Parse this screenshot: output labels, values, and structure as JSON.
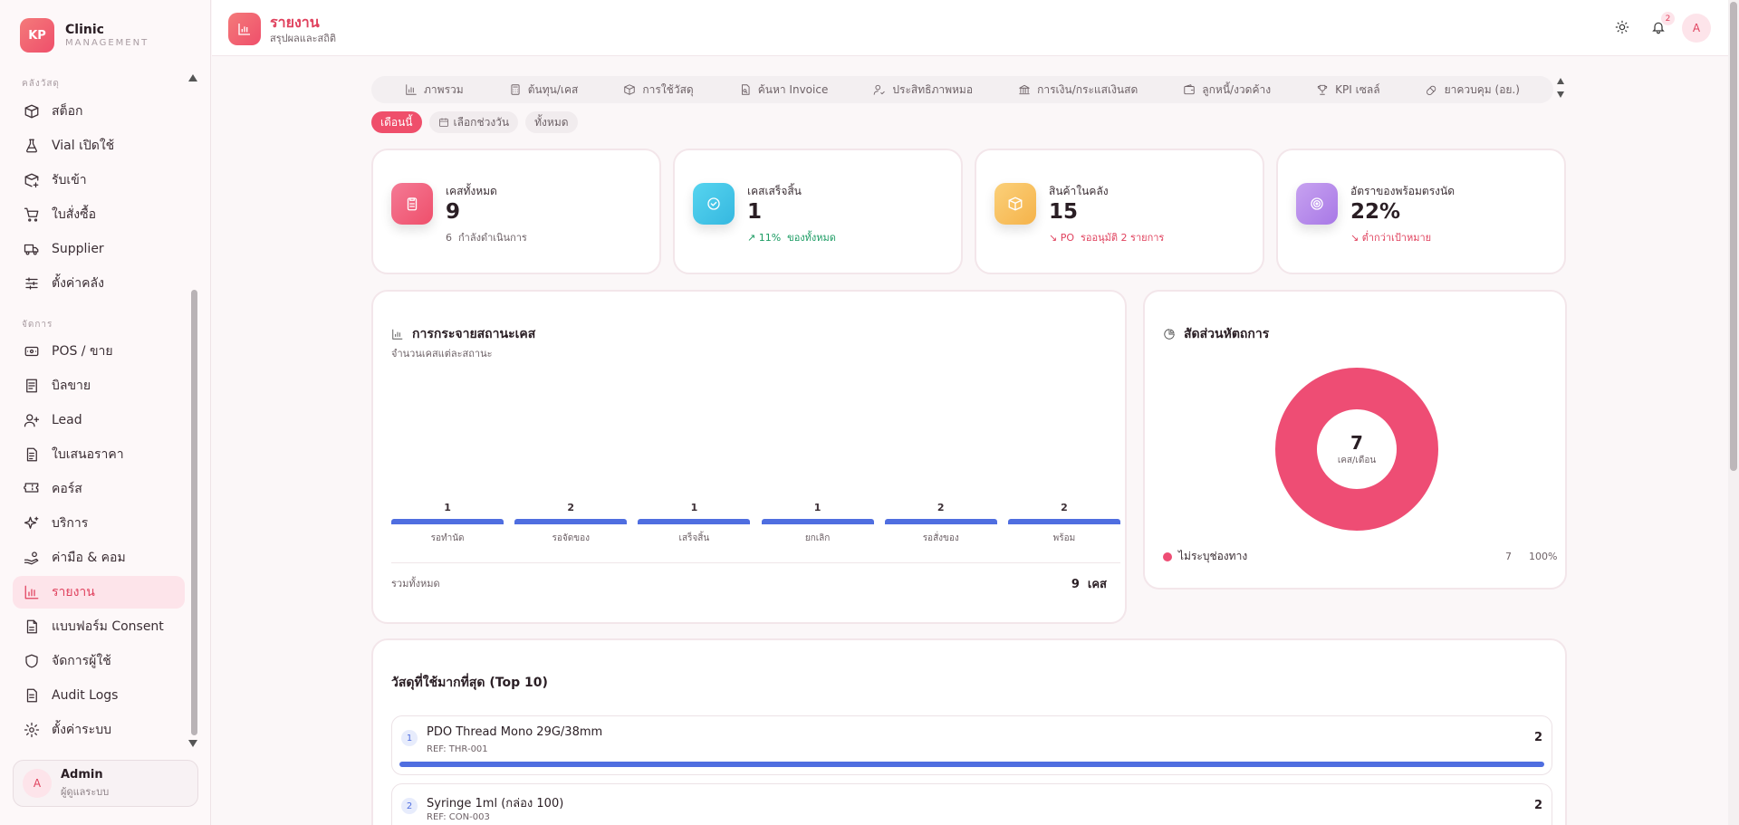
{
  "brand": {
    "logo": "KP",
    "name": "Clinic",
    "sub": "MANAGEMENT"
  },
  "sidebar": {
    "section1": "คลังวัสดุ",
    "section2": "จัดการ",
    "items": [
      {
        "label": "สต็อก",
        "icon": "box-icon"
      },
      {
        "label": "Vial เปิดใช้",
        "icon": "flask-icon"
      },
      {
        "label": "รับเข้า",
        "icon": "package-plus-icon"
      },
      {
        "label": "ใบสั่งซื้อ",
        "icon": "cart-icon"
      },
      {
        "label": "Supplier",
        "icon": "truck-icon"
      },
      {
        "label": "ตั้งค่าคลัง",
        "icon": "sliders-icon"
      },
      {
        "label": "POS / ขาย",
        "icon": "pos-icon"
      },
      {
        "label": "บิลขาย",
        "icon": "receipt-icon"
      },
      {
        "label": "Lead",
        "icon": "user-plus-icon"
      },
      {
        "label": "ใบเสนอราคา",
        "icon": "quote-icon"
      },
      {
        "label": "คอร์ส",
        "icon": "ticket-icon"
      },
      {
        "label": "บริการ",
        "icon": "sparkle-icon"
      },
      {
        "label": "ค่ามือ & คอม",
        "icon": "hand-coins-icon"
      },
      {
        "label": "รายงาน",
        "icon": "chart-icon"
      },
      {
        "label": "แบบฟอร์ม Consent",
        "icon": "document-icon"
      },
      {
        "label": "จัดการผู้ใช้",
        "icon": "shield-icon"
      },
      {
        "label": "Audit Logs",
        "icon": "log-icon"
      },
      {
        "label": "ตั้งค่าระบบ",
        "icon": "gear-icon"
      }
    ],
    "user": {
      "avatar": "A",
      "name": "Admin",
      "role": "ผู้ดูแลระบบ"
    }
  },
  "header": {
    "title": "รายงาน",
    "subtitle": "สรุปผลและสถิติ",
    "notification_count": "2",
    "avatar": "A"
  },
  "tabs": [
    {
      "label": "ภาพรวม",
      "icon": "bar-chart-icon"
    },
    {
      "label": "ต้นทุน/เคส",
      "icon": "calculator-icon"
    },
    {
      "label": "การใช้วัสดุ",
      "icon": "box-icon"
    },
    {
      "label": "ค้นหา Invoice",
      "icon": "file-search-icon"
    },
    {
      "label": "ประสิทธิภาพหมอ",
      "icon": "user-check-icon"
    },
    {
      "label": "การเงิน/กระแสเงินสด",
      "icon": "bank-icon"
    },
    {
      "label": "ลูกหนี้/งวดค้าง",
      "icon": "wallet-icon"
    },
    {
      "label": "KPI เซลล์",
      "icon": "trophy-icon"
    },
    {
      "label": "ยาควบคุม (อย.)",
      "icon": "pill-icon"
    }
  ],
  "filters": {
    "this_month": "เดือนนี้",
    "date_range": "เลือกช่วงวัน",
    "all": "ทั้งหมด"
  },
  "stats": [
    {
      "label": "เคสทั้งหมด",
      "value": "9",
      "note_num": "6",
      "note_text": "กำลังดำเนินการ",
      "color": "#ef4f6b"
    },
    {
      "label": "เคสเสร็จสิ้น",
      "value": "1",
      "note_num": "11%",
      "note_text": "ของทั้งหมด",
      "color": "#3fc3e6"
    },
    {
      "label": "สินค้าในคลัง",
      "value": "15",
      "note_num": "PO",
      "note_text": "รออนุมัติ 2 รายการ",
      "color": "#f7c155"
    },
    {
      "label": "อัตราของพร้อมตรงนัด",
      "value": "22%",
      "note_num": "",
      "note_text": "ต่ำกว่าเป้าหมาย",
      "color": "#b38be6"
    }
  ],
  "status_card": {
    "title": "การกระจายสถานะเคส",
    "subtitle": "จำนวนเคสแต่ละสถานะ",
    "total_label": "รวมทั้งหมด",
    "total_value": "9",
    "total_unit": "เคส"
  },
  "ratio_card": {
    "title": "สัดส่วนหัตถการ",
    "center_value": "7",
    "center_unit": "เคส/เดือน"
  },
  "chart_data": [
    {
      "type": "bar",
      "categories": [
        "รอทำนัด",
        "รอจัดของ",
        "เสร็จสิ้น",
        "ยกเลิก",
        "รอสั่งของ",
        "พร้อม"
      ],
      "values": [
        1,
        2,
        1,
        1,
        2,
        2
      ],
      "color": "#4f6ee0"
    },
    {
      "type": "pie",
      "slices": [
        {
          "label": "ไม่ระบุช่องทาง",
          "value": 7,
          "percent": "100%",
          "color": "#ee4d74"
        }
      ]
    }
  ],
  "top_materials": {
    "title": "วัสดุที่ใช้มากที่สุด (Top 10)",
    "items": [
      {
        "rank": "1",
        "name": "PDO Thread Mono 29G/38mm",
        "ref": "REF: THR-001",
        "count": "2"
      },
      {
        "rank": "2",
        "name": "Syringe 1ml (กล่อง 100)",
        "ref": "REF: CON-003",
        "count": "2"
      }
    ]
  }
}
